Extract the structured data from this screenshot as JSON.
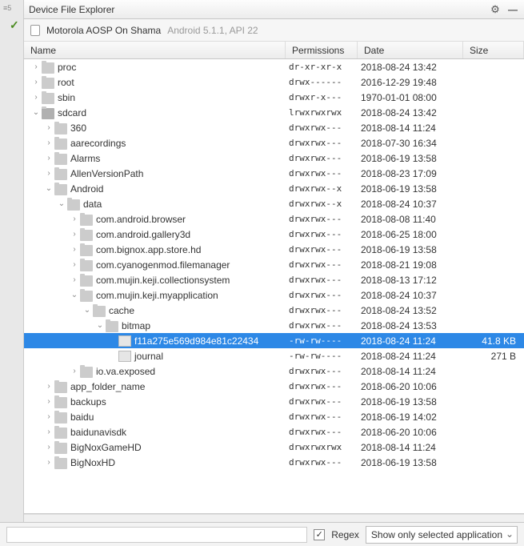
{
  "gutter": {
    "marks": "≡5",
    "check": "✓"
  },
  "toolbar": {
    "title": "Device File Explorer",
    "gear_tip": "Settings",
    "min_tip": "Minimize"
  },
  "device": {
    "name": "Motorola AOSP On Shama",
    "sub": "Android 5.1.1, API 22"
  },
  "columns": {
    "name": "Name",
    "permissions": "Permissions",
    "date": "Date",
    "size": "Size"
  },
  "rows": [
    {
      "d": 1,
      "ex": "col",
      "ic": "folder",
      "name": "proc",
      "perm": "dr-xr-xr-x",
      "date": "2018-08-24 13:42",
      "size": ""
    },
    {
      "d": 1,
      "ex": "col",
      "ic": "folder",
      "name": "root",
      "perm": "drwx------",
      "date": "2016-12-29 19:48",
      "size": ""
    },
    {
      "d": 1,
      "ex": "col",
      "ic": "folder",
      "name": "sbin",
      "perm": "drwxr-x---",
      "date": "1970-01-01 08:00",
      "size": ""
    },
    {
      "d": 1,
      "ex": "exp",
      "ic": "sdfolder",
      "name": "sdcard",
      "perm": "lrwxrwxrwx",
      "date": "2018-08-24 13:42",
      "size": ""
    },
    {
      "d": 2,
      "ex": "col",
      "ic": "folder",
      "name": "360",
      "perm": "drwxrwx---",
      "date": "2018-08-14 11:24",
      "size": ""
    },
    {
      "d": 2,
      "ex": "col",
      "ic": "folder",
      "name": "aarecordings",
      "perm": "drwxrwx---",
      "date": "2018-07-30 16:34",
      "size": ""
    },
    {
      "d": 2,
      "ex": "col",
      "ic": "folder",
      "name": "Alarms",
      "perm": "drwxrwx---",
      "date": "2018-06-19 13:58",
      "size": ""
    },
    {
      "d": 2,
      "ex": "col",
      "ic": "folder",
      "name": "AllenVersionPath",
      "perm": "drwxrwx---",
      "date": "2018-08-23 17:09",
      "size": ""
    },
    {
      "d": 2,
      "ex": "exp",
      "ic": "folder",
      "name": "Android",
      "perm": "drwxrwx--x",
      "date": "2018-06-19 13:58",
      "size": ""
    },
    {
      "d": 3,
      "ex": "exp",
      "ic": "folder",
      "name": "data",
      "perm": "drwxrwx--x",
      "date": "2018-08-24 10:37",
      "size": ""
    },
    {
      "d": 4,
      "ex": "col",
      "ic": "folder",
      "name": "com.android.browser",
      "perm": "drwxrwx---",
      "date": "2018-08-08 11:40",
      "size": ""
    },
    {
      "d": 4,
      "ex": "col",
      "ic": "folder",
      "name": "com.android.gallery3d",
      "perm": "drwxrwx---",
      "date": "2018-06-25 18:00",
      "size": ""
    },
    {
      "d": 4,
      "ex": "col",
      "ic": "folder",
      "name": "com.bignox.app.store.hd",
      "perm": "drwxrwx---",
      "date": "2018-06-19 13:58",
      "size": ""
    },
    {
      "d": 4,
      "ex": "col",
      "ic": "folder",
      "name": "com.cyanogenmod.filemanager",
      "perm": "drwxrwx---",
      "date": "2018-08-21 19:08",
      "size": ""
    },
    {
      "d": 4,
      "ex": "col",
      "ic": "folder",
      "name": "com.mujin.keji.collectionsystem",
      "perm": "drwxrwx---",
      "date": "2018-08-13 17:12",
      "size": ""
    },
    {
      "d": 4,
      "ex": "exp",
      "ic": "folder",
      "name": "com.mujin.keji.myapplication",
      "perm": "drwxrwx---",
      "date": "2018-08-24 10:37",
      "size": ""
    },
    {
      "d": 5,
      "ex": "exp",
      "ic": "folder",
      "name": "cache",
      "perm": "drwxrwx---",
      "date": "2018-08-24 13:52",
      "size": ""
    },
    {
      "d": 6,
      "ex": "exp",
      "ic": "folder",
      "name": "bitmap",
      "perm": "drwxrwx---",
      "date": "2018-08-24 13:53",
      "size": ""
    },
    {
      "d": 7,
      "ex": "none",
      "ic": "file",
      "name": "f11a275e569d984e81c22434",
      "perm": "-rw-rw----",
      "date": "2018-08-24 11:24",
      "size": "41.8 KB",
      "sel": true
    },
    {
      "d": 7,
      "ex": "none",
      "ic": "file",
      "name": "journal",
      "perm": "-rw-rw----",
      "date": "2018-08-24 11:24",
      "size": "271 B"
    },
    {
      "d": 4,
      "ex": "col",
      "ic": "folder",
      "name": "io.va.exposed",
      "perm": "drwxrwx---",
      "date": "2018-08-14 11:24",
      "size": ""
    },
    {
      "d": 2,
      "ex": "col",
      "ic": "folder",
      "name": "app_folder_name",
      "perm": "drwxrwx---",
      "date": "2018-06-20 10:06",
      "size": ""
    },
    {
      "d": 2,
      "ex": "col",
      "ic": "folder",
      "name": "backups",
      "perm": "drwxrwx---",
      "date": "2018-06-19 13:58",
      "size": ""
    },
    {
      "d": 2,
      "ex": "col",
      "ic": "folder",
      "name": "baidu",
      "perm": "drwxrwx---",
      "date": "2018-06-19 14:02",
      "size": ""
    },
    {
      "d": 2,
      "ex": "col",
      "ic": "folder",
      "name": "baidunavisdk",
      "perm": "drwxrwx---",
      "date": "2018-06-20 10:06",
      "size": ""
    },
    {
      "d": 2,
      "ex": "col",
      "ic": "folder",
      "name": "BigNoxGameHD",
      "perm": "drwxrwxrwx",
      "date": "2018-08-14 11:24",
      "size": ""
    },
    {
      "d": 2,
      "ex": "col",
      "ic": "folder",
      "name": "BigNoxHD",
      "perm": "drwxrwx---",
      "date": "2018-06-19 13:58",
      "size": ""
    }
  ],
  "footer": {
    "regex_label": "Regex",
    "regex_checked": true,
    "filter_label": "Show only selected application"
  }
}
